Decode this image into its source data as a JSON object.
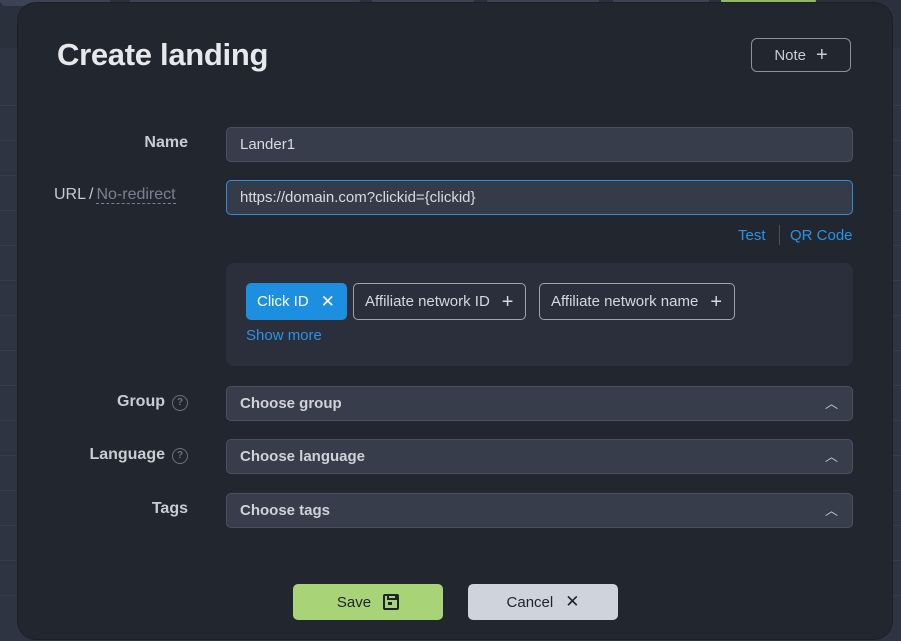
{
  "modal": {
    "title": "Create landing",
    "note_label": "Note"
  },
  "fields": {
    "name_label": "Name",
    "name_value": "Lander1",
    "url_label": "URL",
    "url_separator": "/",
    "no_redirect_label": "No-redirect",
    "url_value": "https://domain.com?clickid={clickid}",
    "test_link": "Test",
    "qr_link": "QR Code",
    "group_label": "Group",
    "group_placeholder": "Choose group",
    "language_label": "Language",
    "language_placeholder": "Choose language",
    "tags_label": "Tags",
    "tags_placeholder": "Choose tags"
  },
  "macros": {
    "chips": [
      {
        "label": "Click ID",
        "state": "selected"
      },
      {
        "label": "Affiliate network ID",
        "state": "available"
      },
      {
        "label": "Affiliate network name",
        "state": "available"
      }
    ],
    "show_more": "Show more"
  },
  "actions": {
    "save_label": "Save",
    "cancel_label": "Cancel"
  },
  "colors": {
    "accent": "#1d8fe1",
    "save": "#a8d477",
    "cancel": "#cfd3db",
    "modal_bg": "#22262f"
  },
  "icons": {
    "note": "plus-icon",
    "chip_selected": "close-icon",
    "chip_available": "plus-icon",
    "help": "question-circle-icon",
    "select": "chevron-up-icon",
    "save": "floppy-disk-icon",
    "cancel": "close-icon"
  }
}
